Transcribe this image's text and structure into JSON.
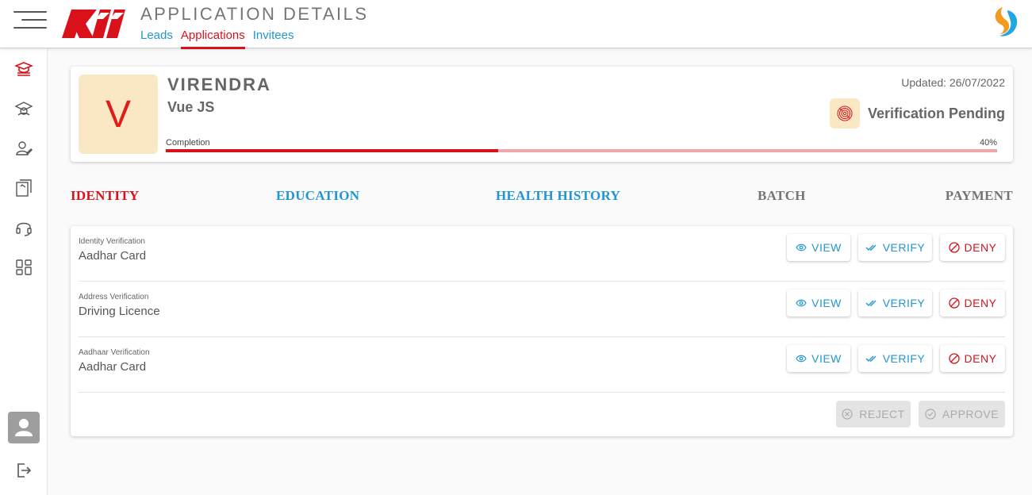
{
  "header": {
    "title": "APPLICATION DETAILS",
    "logo_text": "Kii",
    "tabs": [
      {
        "label": "Leads",
        "active": false
      },
      {
        "label": "Applications",
        "active": true
      },
      {
        "label": "Invitees",
        "active": false
      }
    ]
  },
  "sidebar": {
    "items": [
      {
        "icon": "graduation-cap-icon",
        "active": true
      },
      {
        "icon": "school-icon",
        "active": false
      },
      {
        "icon": "user-edit-icon",
        "active": false
      },
      {
        "icon": "books-icon",
        "active": false
      },
      {
        "icon": "headset-icon",
        "active": false
      },
      {
        "icon": "grid-icon",
        "active": false
      }
    ],
    "bottom": [
      "avatar-icon",
      "logout-icon"
    ]
  },
  "profile": {
    "initial": "V",
    "name": "VIRENDRA",
    "course": "Vue JS",
    "updated": "Updated: 26/07/2022",
    "status": "Verification Pending",
    "completion_label": "Completion",
    "completion_pct_text": "40%",
    "completion_value": 0.4
  },
  "sections": [
    {
      "label": "IDENTITY",
      "state": "active"
    },
    {
      "label": "EDUCATION",
      "state": "link"
    },
    {
      "label": "HEALTH HISTORY",
      "state": "link"
    },
    {
      "label": "BATCH",
      "state": "muted"
    },
    {
      "label": "PAYMENT",
      "state": "muted"
    }
  ],
  "verifications": [
    {
      "label": "Identity Verification",
      "value": "Aadhar Card"
    },
    {
      "label": "Address Verification",
      "value": "Driving Licence"
    },
    {
      "label": "Aadhaar Verification",
      "value": "Aadhar Card"
    }
  ],
  "buttons": {
    "view": "VIEW",
    "verify": "VERIFY",
    "deny": "DENY",
    "reject": "REJECT",
    "approve": "APPROVE"
  },
  "colors": {
    "accent_red": "#d9111b",
    "link_blue": "#2196d3",
    "muted_text": "#757575",
    "avatar_bg": "#fae8c4",
    "progress_track": "#f0a6ab"
  }
}
